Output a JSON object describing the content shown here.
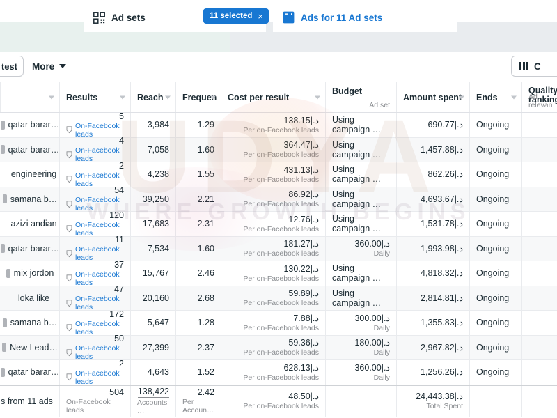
{
  "tabs": {
    "adsets": {
      "label": "Ad sets",
      "icon": "grid-icon"
    },
    "ads": {
      "label": "Ads for 11 Ad sets",
      "icon": "ads-icon"
    },
    "selected_pill": {
      "label": "11 selected",
      "close": "×"
    }
  },
  "toolbar": {
    "test_label": "test",
    "more_label": "More",
    "columns_label": "C",
    "accent": "#1877d2"
  },
  "table": {
    "columns": [
      {
        "key": "name",
        "label": "",
        "sub": ""
      },
      {
        "key": "results",
        "label": "Results",
        "sub": ""
      },
      {
        "key": "reach",
        "label": "Reach",
        "sub": ""
      },
      {
        "key": "freq",
        "label": "Frequen",
        "sub": ""
      },
      {
        "key": "cost",
        "label": "Cost per result",
        "sub": ""
      },
      {
        "key": "budget",
        "label": "Budget",
        "sub": "Ad set"
      },
      {
        "key": "spent",
        "label": "Amount spent",
        "sub": ""
      },
      {
        "key": "ends",
        "label": "Ends",
        "sub": ""
      },
      {
        "key": "quality",
        "label": "Quality ranking",
        "sub": "Ad relevan"
      }
    ],
    "rows": [
      {
        "name": "qatar barar…",
        "toggle": "on",
        "results": "5",
        "results_sub": "On-Facebook leads",
        "reach": "3,984",
        "freq": "1.29",
        "cost": "138.15|.د",
        "cost_sub": "Per on-Facebook leads",
        "budget": "Using campaign …",
        "budget_sub": "",
        "spent": "690.77|.د",
        "ends": "Ongoing"
      },
      {
        "name": "qatar barar…",
        "toggle": "on",
        "results": "4",
        "results_sub": "On-Facebook leads",
        "reach": "7,058",
        "freq": "1.60",
        "cost": "364.47|.د",
        "cost_sub": "Per on-Facebook leads",
        "budget": "Using campaign …",
        "budget_sub": "",
        "spent": "1,457.88|.د",
        "ends": "Ongoing"
      },
      {
        "name": "engineering",
        "toggle": "off",
        "results": "2",
        "results_sub": "On-Facebook leads",
        "reach": "4,238",
        "freq": "1.55",
        "cost": "431.13|.د",
        "cost_sub": "Per on-Facebook leads",
        "budget": "Using campaign …",
        "budget_sub": "",
        "spent": "862.26|.د",
        "ends": "Ongoing"
      },
      {
        "name": "samana b…",
        "toggle": "on",
        "results": "54",
        "results_sub": "On-Facebook leads",
        "reach": "39,250",
        "freq": "2.21",
        "cost": "86.92|.د",
        "cost_sub": "Per on-Facebook leads",
        "budget": "Using campaign …",
        "budget_sub": "",
        "spent": "4,693.67|.د",
        "ends": "Ongoing"
      },
      {
        "name": "azizi andian",
        "toggle": "off",
        "results": "120",
        "results_sub": "On-Facebook leads",
        "reach": "17,683",
        "freq": "2.31",
        "cost": "12.76|.د",
        "cost_sub": "Per on-Facebook leads",
        "budget": "Using campaign …",
        "budget_sub": "",
        "spent": "1,531.78|.د",
        "ends": "Ongoing"
      },
      {
        "name": "qatar barar…",
        "toggle": "on",
        "results": "11",
        "results_sub": "On-Facebook leads",
        "reach": "7,534",
        "freq": "1.60",
        "cost": "181.27|.د",
        "cost_sub": "Per on-Facebook leads",
        "budget": "360.00|.د",
        "budget_sub": "Daily",
        "spent": "1,993.98|.د",
        "ends": "Ongoing"
      },
      {
        "name": "mix jordon",
        "toggle": "on",
        "results": "37",
        "results_sub": "On-Facebook leads",
        "reach": "15,767",
        "freq": "2.46",
        "cost": "130.22|.د",
        "cost_sub": "Per on-Facebook leads",
        "budget": "Using campaign …",
        "budget_sub": "",
        "spent": "4,818.32|.د",
        "ends": "Ongoing"
      },
      {
        "name": "loka like",
        "toggle": "off",
        "results": "47",
        "results_sub": "On-Facebook leads",
        "reach": "20,160",
        "freq": "2.68",
        "cost": "59.89|.د",
        "cost_sub": "Per on-Facebook leads",
        "budget": "Using campaign …",
        "budget_sub": "",
        "spent": "2,814.81|.د",
        "ends": "Ongoing"
      },
      {
        "name": "samana b…",
        "toggle": "on",
        "results": "172",
        "results_sub": "On-Facebook leads",
        "reach": "5,647",
        "freq": "1.28",
        "cost": "7.88|.د",
        "cost_sub": "Per on-Facebook leads",
        "budget": "300.00|.د",
        "budget_sub": "Daily",
        "spent": "1,355.83|.د",
        "ends": "Ongoing"
      },
      {
        "name": "New Lead…",
        "toggle": "on",
        "results": "50",
        "results_sub": "On-Facebook leads",
        "reach": "27,399",
        "freq": "2.37",
        "cost": "59.36|.د",
        "cost_sub": "Per on-Facebook leads",
        "budget": "180.00|.د",
        "budget_sub": "Daily",
        "spent": "2,967.82|.د",
        "ends": "Ongoing"
      },
      {
        "name": "qatar barar…",
        "toggle": "on",
        "results": "2",
        "results_sub": "On-Facebook leads",
        "reach": "4,643",
        "freq": "1.52",
        "cost": "628.13|.د",
        "cost_sub": "Per on-Facebook leads",
        "budget": "360.00|.د",
        "budget_sub": "Daily",
        "spent": "1,256.26|.د",
        "ends": "Ongoing"
      }
    ],
    "summary": {
      "name": "s from 11 ads",
      "results": "504",
      "results_sub": "On-Facebook leads",
      "reach": "138,422",
      "reach_sub": "Accounts …",
      "freq": "2.42",
      "freq_sub": "Per Accoun…",
      "cost": "48.50|.د",
      "cost_sub": "Per on-Facebook leads",
      "budget": "",
      "budget_sub": "",
      "spent": "24,443.38|.د",
      "spent_sub": "Total Spent",
      "ends": ""
    }
  },
  "watermark": {
    "main": "UDYA",
    "sub": "WHERE GROWTH BEGINS"
  }
}
